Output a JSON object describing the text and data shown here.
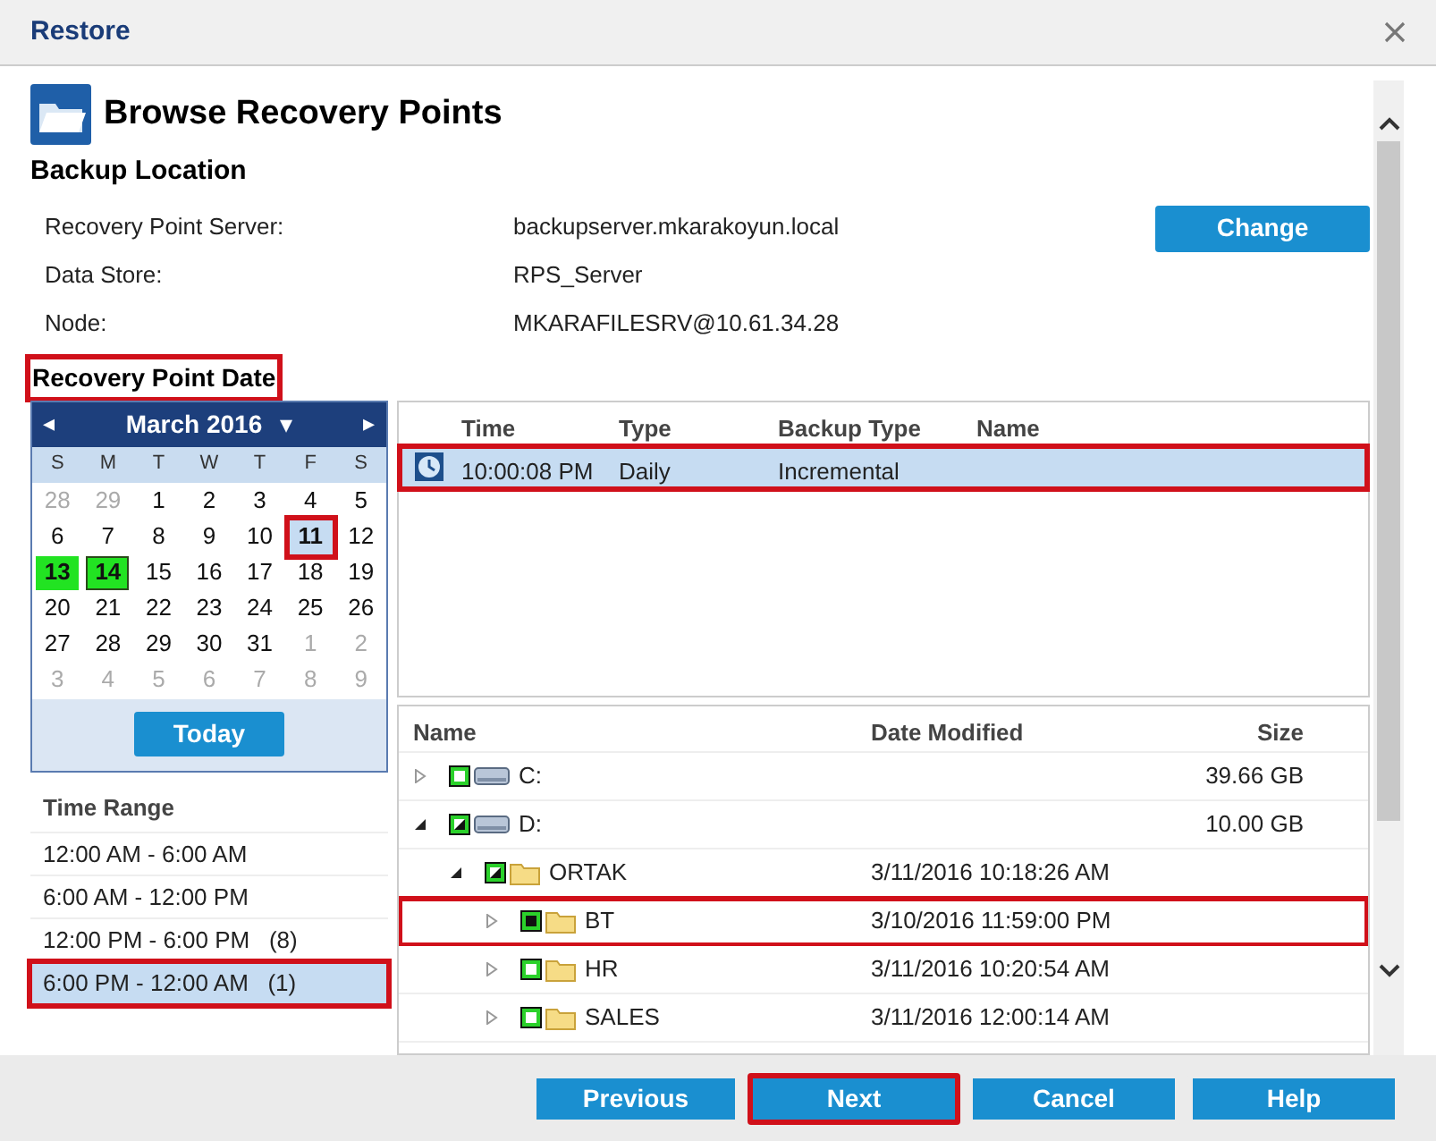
{
  "window": {
    "title": "Restore"
  },
  "page_title": "Browse Recovery Points",
  "backup_location": {
    "heading": "Backup Location",
    "fields": [
      {
        "label": "Recovery Point Server:",
        "value": "backupserver.mkarakoyun.local"
      },
      {
        "label": "Data Store:",
        "value": "RPS_Server"
      },
      {
        "label": "Node:",
        "value": "MKARAFILESRV@10.61.34.28"
      }
    ],
    "change_button": "Change"
  },
  "recovery_point_date": {
    "heading": "Recovery Point Date",
    "highlighted": true
  },
  "calendar": {
    "prev": "◂",
    "month": "March 2016",
    "dropdown": "▾",
    "next": "▸",
    "weekdays": [
      "S",
      "M",
      "T",
      "W",
      "T",
      "F",
      "S"
    ],
    "days": [
      {
        "label": "28",
        "kind": "outside",
        "selected": false,
        "highlighted": false
      },
      {
        "label": "29",
        "kind": "outside",
        "selected": false,
        "highlighted": false
      },
      {
        "label": "1",
        "kind": "normal",
        "selected": false,
        "highlighted": false
      },
      {
        "label": "2",
        "kind": "normal",
        "selected": false,
        "highlighted": false
      },
      {
        "label": "3",
        "kind": "normal",
        "selected": false,
        "highlighted": false
      },
      {
        "label": "4",
        "kind": "normal",
        "selected": false,
        "highlighted": false
      },
      {
        "label": "5",
        "kind": "normal",
        "selected": false,
        "highlighted": false
      },
      {
        "label": "6",
        "kind": "normal",
        "selected": false,
        "highlighted": false
      },
      {
        "label": "7",
        "kind": "normal",
        "selected": false,
        "highlighted": false
      },
      {
        "label": "8",
        "kind": "normal",
        "selected": false,
        "highlighted": false
      },
      {
        "label": "9",
        "kind": "normal",
        "selected": false,
        "highlighted": false
      },
      {
        "label": "10",
        "kind": "normal",
        "selected": false,
        "highlighted": false
      },
      {
        "label": "11",
        "kind": "normal",
        "selected": true,
        "highlighted": true
      },
      {
        "label": "12",
        "kind": "normal",
        "selected": false,
        "highlighted": false
      },
      {
        "label": "13",
        "kind": "backup",
        "selected": false,
        "highlighted": false
      },
      {
        "label": "14",
        "kind": "today",
        "selected": false,
        "highlighted": false
      },
      {
        "label": "15",
        "kind": "normal",
        "selected": false,
        "highlighted": false
      },
      {
        "label": "16",
        "kind": "normal",
        "selected": false,
        "highlighted": false
      },
      {
        "label": "17",
        "kind": "normal",
        "selected": false,
        "highlighted": false
      },
      {
        "label": "18",
        "kind": "normal",
        "selected": false,
        "highlighted": false
      },
      {
        "label": "19",
        "kind": "normal",
        "selected": false,
        "highlighted": false
      },
      {
        "label": "20",
        "kind": "normal",
        "selected": false,
        "highlighted": false
      },
      {
        "label": "21",
        "kind": "normal",
        "selected": false,
        "highlighted": false
      },
      {
        "label": "22",
        "kind": "normal",
        "selected": false,
        "highlighted": false
      },
      {
        "label": "23",
        "kind": "normal",
        "selected": false,
        "highlighted": false
      },
      {
        "label": "24",
        "kind": "normal",
        "selected": false,
        "highlighted": false
      },
      {
        "label": "25",
        "kind": "normal",
        "selected": false,
        "highlighted": false
      },
      {
        "label": "26",
        "kind": "normal",
        "selected": false,
        "highlighted": false
      },
      {
        "label": "27",
        "kind": "normal",
        "selected": false,
        "highlighted": false
      },
      {
        "label": "28",
        "kind": "normal",
        "selected": false,
        "highlighted": false
      },
      {
        "label": "29",
        "kind": "normal",
        "selected": false,
        "highlighted": false
      },
      {
        "label": "30",
        "kind": "normal",
        "selected": false,
        "highlighted": false
      },
      {
        "label": "31",
        "kind": "normal",
        "selected": false,
        "highlighted": false
      },
      {
        "label": "1",
        "kind": "outside",
        "selected": false,
        "highlighted": false
      },
      {
        "label": "2",
        "kind": "outside",
        "selected": false,
        "highlighted": false
      },
      {
        "label": "3",
        "kind": "outside",
        "selected": false,
        "highlighted": false
      },
      {
        "label": "4",
        "kind": "outside",
        "selected": false,
        "highlighted": false
      },
      {
        "label": "5",
        "kind": "outside",
        "selected": false,
        "highlighted": false
      },
      {
        "label": "6",
        "kind": "outside",
        "selected": false,
        "highlighted": false
      },
      {
        "label": "7",
        "kind": "outside",
        "selected": false,
        "highlighted": false
      },
      {
        "label": "8",
        "kind": "outside",
        "selected": false,
        "highlighted": false
      },
      {
        "label": "9",
        "kind": "outside",
        "selected": false,
        "highlighted": false
      }
    ],
    "today_button": "Today"
  },
  "time_range": {
    "heading": "Time Range",
    "items": [
      {
        "label": "12:00 AM - 6:00 AM",
        "selected": false,
        "highlighted": false
      },
      {
        "label": "6:00 AM - 12:00 PM",
        "selected": false,
        "highlighted": false
      },
      {
        "label": "12:00 PM - 6:00 PM   (8)",
        "selected": false,
        "highlighted": false
      },
      {
        "label": "6:00 PM - 12:00 AM   (1)",
        "selected": true,
        "highlighted": true
      }
    ]
  },
  "recovery_points": {
    "columns": [
      "Time",
      "Type",
      "Backup Type",
      "Name"
    ],
    "rows": [
      {
        "time": "10:00:08 PM",
        "type": "Daily",
        "backup_type": "Incremental",
        "selected": true,
        "highlighted": true
      }
    ]
  },
  "file_tree": {
    "columns": [
      "Name",
      "Date Modified",
      "Size"
    ],
    "nodes": [
      {
        "name": "C:",
        "kind": "drive",
        "checked": false,
        "partial": false,
        "expanded": false,
        "size": "39.66 GB",
        "highlighted": false
      },
      {
        "name": "D:",
        "kind": "drive",
        "checked": false,
        "partial": true,
        "expanded": true,
        "size": "10.00 GB",
        "highlighted": false,
        "children": [
          {
            "name": "ORTAK",
            "kind": "folder",
            "checked": false,
            "partial": true,
            "expanded": true,
            "date_modified": "3/11/2016 10:18:26 AM",
            "highlighted": false,
            "children": [
              {
                "name": "BT",
                "kind": "folder",
                "checked": true,
                "partial": false,
                "expanded": false,
                "date_modified": "3/10/2016 11:59:00 PM",
                "highlighted": true
              },
              {
                "name": "HR",
                "kind": "folder",
                "checked": false,
                "partial": false,
                "expanded": false,
                "date_modified": "3/11/2016 10:20:54 AM",
                "highlighted": false
              },
              {
                "name": "SALES",
                "kind": "folder",
                "checked": false,
                "partial": false,
                "expanded": false,
                "date_modified": "3/11/2016 12:00:14 AM",
                "highlighted": false
              }
            ]
          }
        ]
      }
    ]
  },
  "footer_buttons": [
    {
      "label": "Previous",
      "highlighted": false
    },
    {
      "label": "Next",
      "highlighted": true
    },
    {
      "label": "Cancel",
      "highlighted": false
    },
    {
      "label": "Help",
      "highlighted": false
    }
  ]
}
